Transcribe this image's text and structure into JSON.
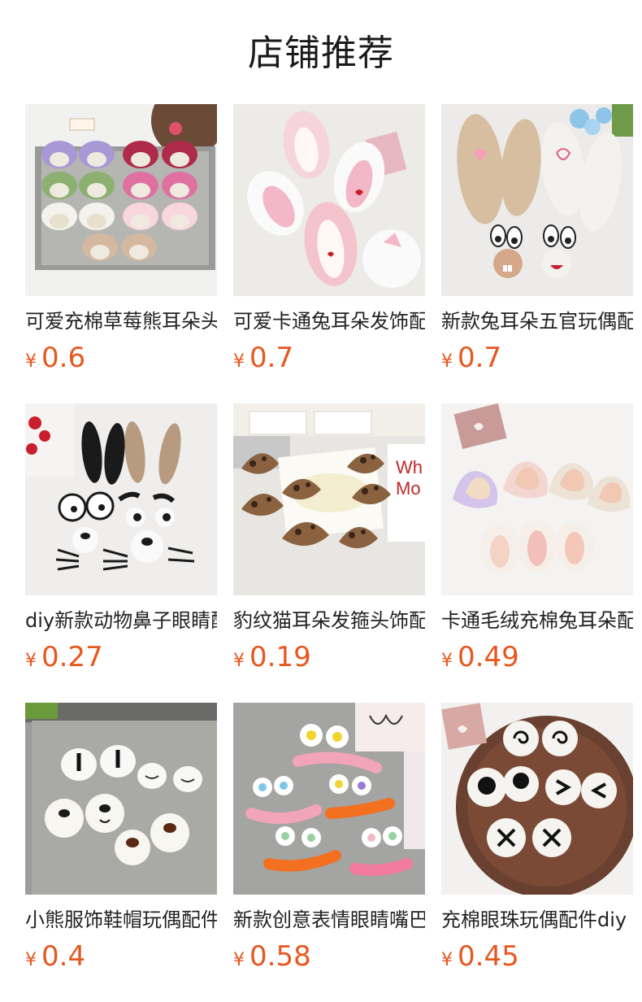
{
  "page": {
    "title": "店铺推荐"
  },
  "currency_symbol": "¥",
  "products": [
    {
      "name": "可爱充棉草莓熊耳朵头饰",
      "price": "0.6",
      "thumb_icon": "bear-ears-tray-image"
    },
    {
      "name": "可爱卡通兔耳朵发饰配件",
      "price": "0.7",
      "thumb_icon": "bunny-ears-image"
    },
    {
      "name": "新款兔耳朵五官玩偶配件",
      "price": "0.7",
      "thumb_icon": "embroidered-bunny-ears-image"
    },
    {
      "name": "diy新款动物鼻子眼睛配件",
      "price": "0.27",
      "thumb_icon": "animal-face-parts-image"
    },
    {
      "name": "豹纹猫耳朵发箍头饰配件",
      "price": "0.19",
      "thumb_icon": "leopard-cat-ears-image"
    },
    {
      "name": "卡通毛绒充棉兔耳朵配件",
      "price": "0.49",
      "thumb_icon": "plush-cat-ears-image"
    },
    {
      "name": "小熊服饰鞋帽玩偶配件",
      "price": "0.4",
      "thumb_icon": "bear-eyes-noses-image"
    },
    {
      "name": "新款创意表情眼睛嘴巴配件",
      "price": "0.58",
      "thumb_icon": "expression-eyes-mouths-image"
    },
    {
      "name": "充棉眼珠玩偶配件diy",
      "price": "0.45",
      "thumb_icon": "plush-eyeballs-plate-image"
    }
  ],
  "colors": {
    "price": "#e8571e",
    "title": "#1a1a1a",
    "text": "#222222"
  }
}
